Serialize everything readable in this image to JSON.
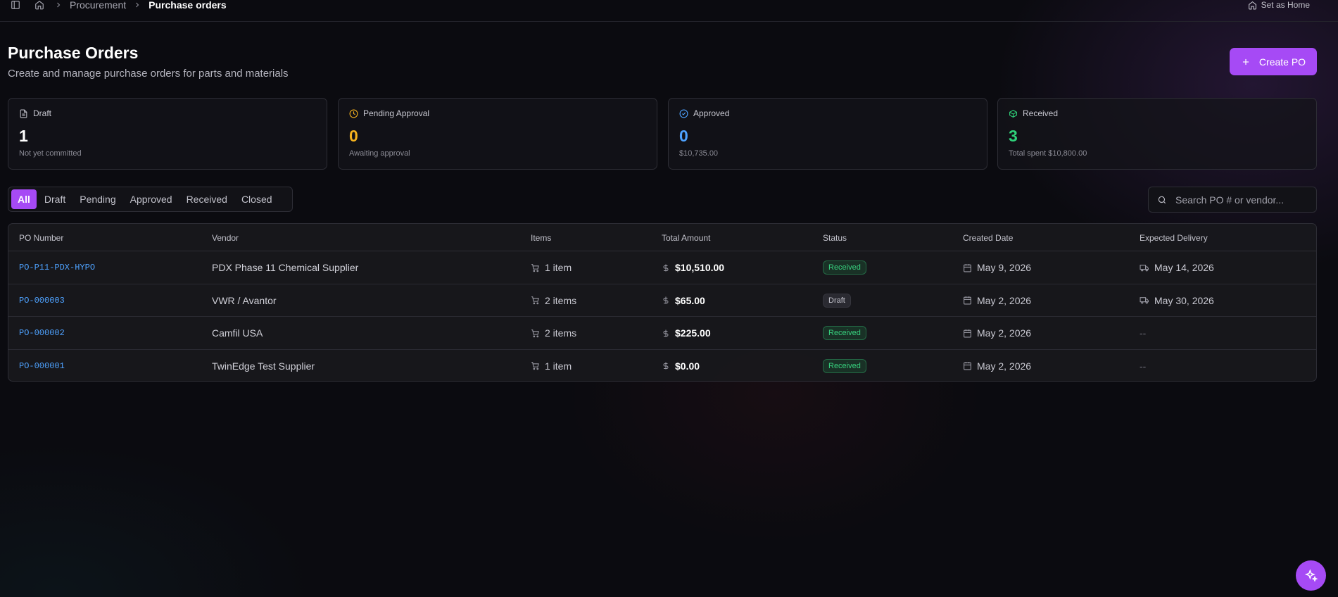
{
  "topbar": {
    "breadcrumb": [
      "Procurement",
      "Purchase orders"
    ],
    "set_home_label": "Set as Home"
  },
  "header": {
    "title": "Purchase Orders",
    "subtitle": "Create and manage purchase orders for parts and materials",
    "create_button": "Create PO"
  },
  "stats": [
    {
      "label": "Draft",
      "value": "1",
      "sub": "Not yet committed",
      "color": "#ffffff",
      "icon": "document-icon"
    },
    {
      "label": "Pending Approval",
      "value": "0",
      "sub": "Awaiting approval",
      "color": "#f5b21e",
      "icon": "clock-icon"
    },
    {
      "label": "Approved",
      "value": "0",
      "sub": "$10,735.00",
      "color": "#4ea2ff",
      "icon": "check-circle-icon"
    },
    {
      "label": "Received",
      "value": "3",
      "sub": "Total spent $10,800.00",
      "color": "#2fd27a",
      "icon": "package-icon"
    }
  ],
  "filters": {
    "tabs": [
      "All",
      "Draft",
      "Pending",
      "Approved",
      "Received",
      "Closed"
    ],
    "active": "All"
  },
  "search": {
    "placeholder": "Search PO # or vendor..."
  },
  "table": {
    "columns": [
      "PO Number",
      "Vendor",
      "Items",
      "Total Amount",
      "Status",
      "Created Date",
      "Expected Delivery"
    ],
    "rows": [
      {
        "po": "PO-P11-PDX-HYPO",
        "vendor": "PDX Phase 11 Chemical Supplier",
        "items": "1 item",
        "amount": "$10,510.00",
        "status": "Received",
        "created": "May 9, 2026",
        "delivery": "May 14, 2026"
      },
      {
        "po": "PO-000003",
        "vendor": "VWR / Avantor",
        "items": "2 items",
        "amount": "$65.00",
        "status": "Draft",
        "created": "May 2, 2026",
        "delivery": "May 30, 2026"
      },
      {
        "po": "PO-000002",
        "vendor": "Camfil USA",
        "items": "2 items",
        "amount": "$225.00",
        "status": "Received",
        "created": "May 2, 2026",
        "delivery": "--"
      },
      {
        "po": "PO-000001",
        "vendor": "TwinEdge Test Supplier",
        "items": "1 item",
        "amount": "$0.00",
        "status": "Received",
        "created": "May 2, 2026",
        "delivery": "--"
      }
    ]
  },
  "colors": {
    "accent": "#a64af5",
    "link": "#4ea2ff",
    "received": "#38d27f",
    "pending": "#f5b21e"
  }
}
